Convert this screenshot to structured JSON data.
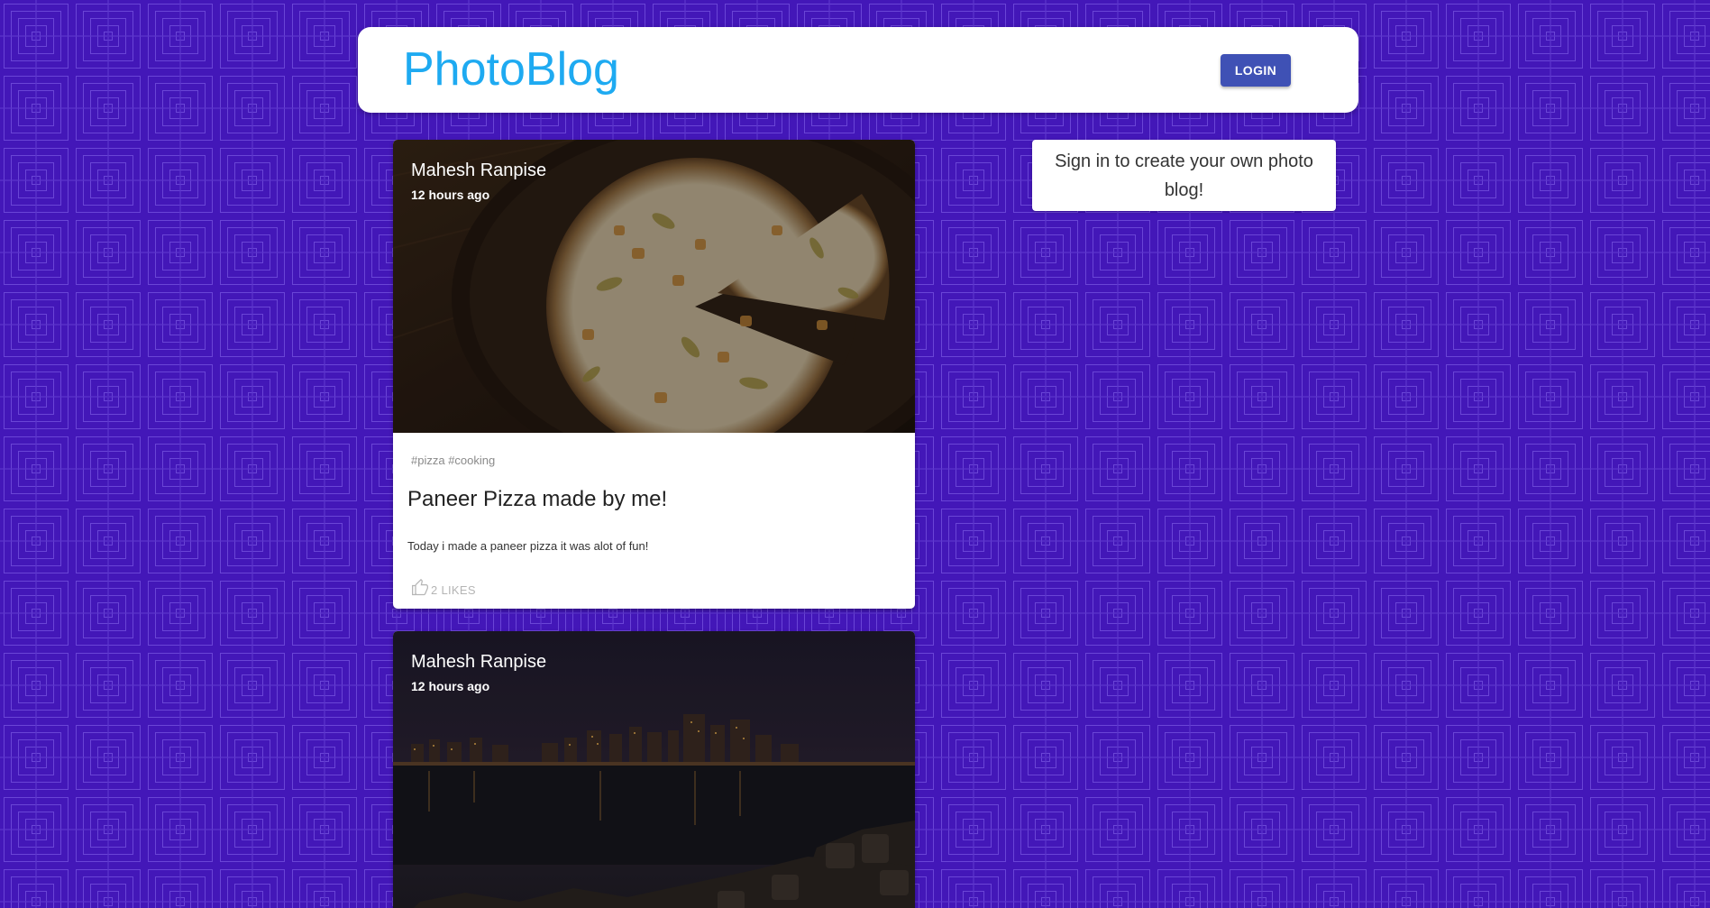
{
  "app": {
    "brand": "PhotoBlog",
    "login_label": "LOGIN"
  },
  "colors": {
    "background": "#4317b8",
    "pattern_line": "#6a45d6",
    "brand": "#1eaaf1",
    "login_button": "#3f51b5"
  },
  "sidebar": {
    "signin_message": "Sign in to create your own photo blog!"
  },
  "posts": [
    {
      "author": "Mahesh Ranpise",
      "time": "12 hours ago",
      "image": "pizza-photo",
      "tags": "#pizza #cooking",
      "title": "Paneer Pizza made by me!",
      "body": "Today i made a paneer pizza it was alot of fun!",
      "likes": "2 LIKES"
    },
    {
      "author": "Mahesh Ranpise",
      "time": "12 hours ago",
      "image": "night-city-skyline-photo"
    }
  ]
}
